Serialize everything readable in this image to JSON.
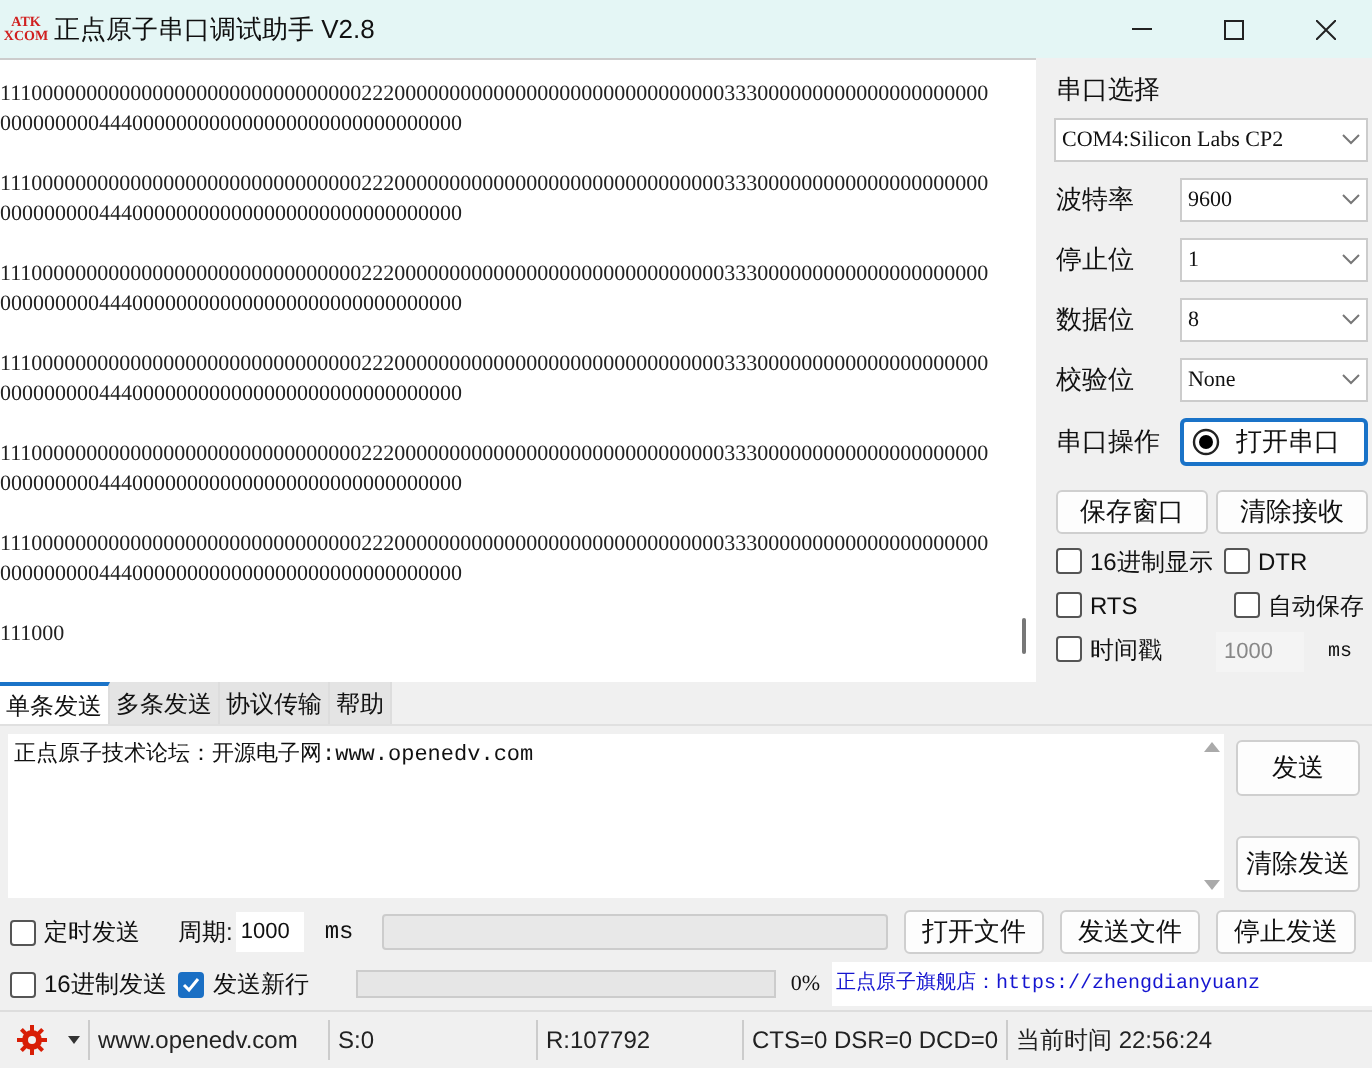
{
  "window": {
    "title": "正点原子串口调试助手 V2.8",
    "logo": [
      "ATK",
      "XCOM"
    ]
  },
  "received": [
    {
      "lines": [
        "111000000000000000000000000000000222000000000000000000000000000000333000000000000000000000",
        "000000000444000000000000000000000000000000"
      ]
    },
    {
      "lines": [
        "111000000000000000000000000000000222000000000000000000000000000000333000000000000000000000",
        "000000000444000000000000000000000000000000"
      ]
    },
    {
      "lines": [
        "111000000000000000000000000000000222000000000000000000000000000000333000000000000000000000",
        "000000000444000000000000000000000000000000"
      ]
    },
    {
      "lines": [
        "111000000000000000000000000000000222000000000000000000000000000000333000000000000000000000",
        "000000000444000000000000000000000000000000"
      ]
    },
    {
      "lines": [
        "111000000000000000000000000000000222000000000000000000000000000000333000000000000000000000",
        "000000000444000000000000000000000000000000"
      ]
    },
    {
      "lines": [
        "111000000000000000000000000000000222000000000000000000000000000000333000000000000000000000",
        "000000000444000000000000000000000000000000"
      ]
    },
    {
      "lines": [
        "111000"
      ]
    }
  ],
  "port": {
    "label": "串口选择",
    "value": "COM4:Silicon Labs CP2"
  },
  "settings": [
    {
      "label": "波特率",
      "value": "9600"
    },
    {
      "label": "停止位",
      "value": "1"
    },
    {
      "label": "数据位",
      "value": "8"
    },
    {
      "label": "校验位",
      "value": "None"
    }
  ],
  "operation": {
    "label": "串口操作",
    "button": "打开串口",
    "open": false
  },
  "receive_buttons": [
    "保存窗口",
    "清除接收"
  ],
  "receive_options": [
    {
      "label": "16进制显示",
      "checked": false
    },
    {
      "label": "DTR",
      "checked": false
    },
    {
      "label": "RTS",
      "checked": false
    },
    {
      "label": "自动保存",
      "checked": false
    },
    {
      "label": "时间戳",
      "checked": false
    }
  ],
  "timestamp_interval": {
    "value": "1000",
    "unit": "ms",
    "disabled": true
  },
  "tabs": [
    {
      "label": "单条发送",
      "selected": true
    },
    {
      "label": "多条发送",
      "selected": false
    },
    {
      "label": "协议传输",
      "selected": false
    },
    {
      "label": "帮助",
      "selected": false
    }
  ],
  "send_text": "正点原子技术论坛：开源电子网:www.openedv.com",
  "send_buttons": [
    "发送",
    "清除发送"
  ],
  "timed_send": {
    "label": "定时发送",
    "checked": false
  },
  "period": {
    "label": "周期:",
    "value": "1000",
    "unit": "ms"
  },
  "file_buttons": [
    "打开文件",
    "发送文件",
    "停止发送"
  ],
  "hex_send": {
    "label": "16进制发送",
    "checked": false
  },
  "newline": {
    "label": "发送新行",
    "checked": true
  },
  "progress": {
    "level": 0,
    "reading": "0%"
  },
  "store_link": "正点原子旗舰店：https://zhengdianyuanz",
  "status_bar": [
    "www.openedv.com",
    "S:0",
    "R:107792",
    "CTS=0 DSR=0 DCD=0",
    "当前时间 22:56:24"
  ]
}
